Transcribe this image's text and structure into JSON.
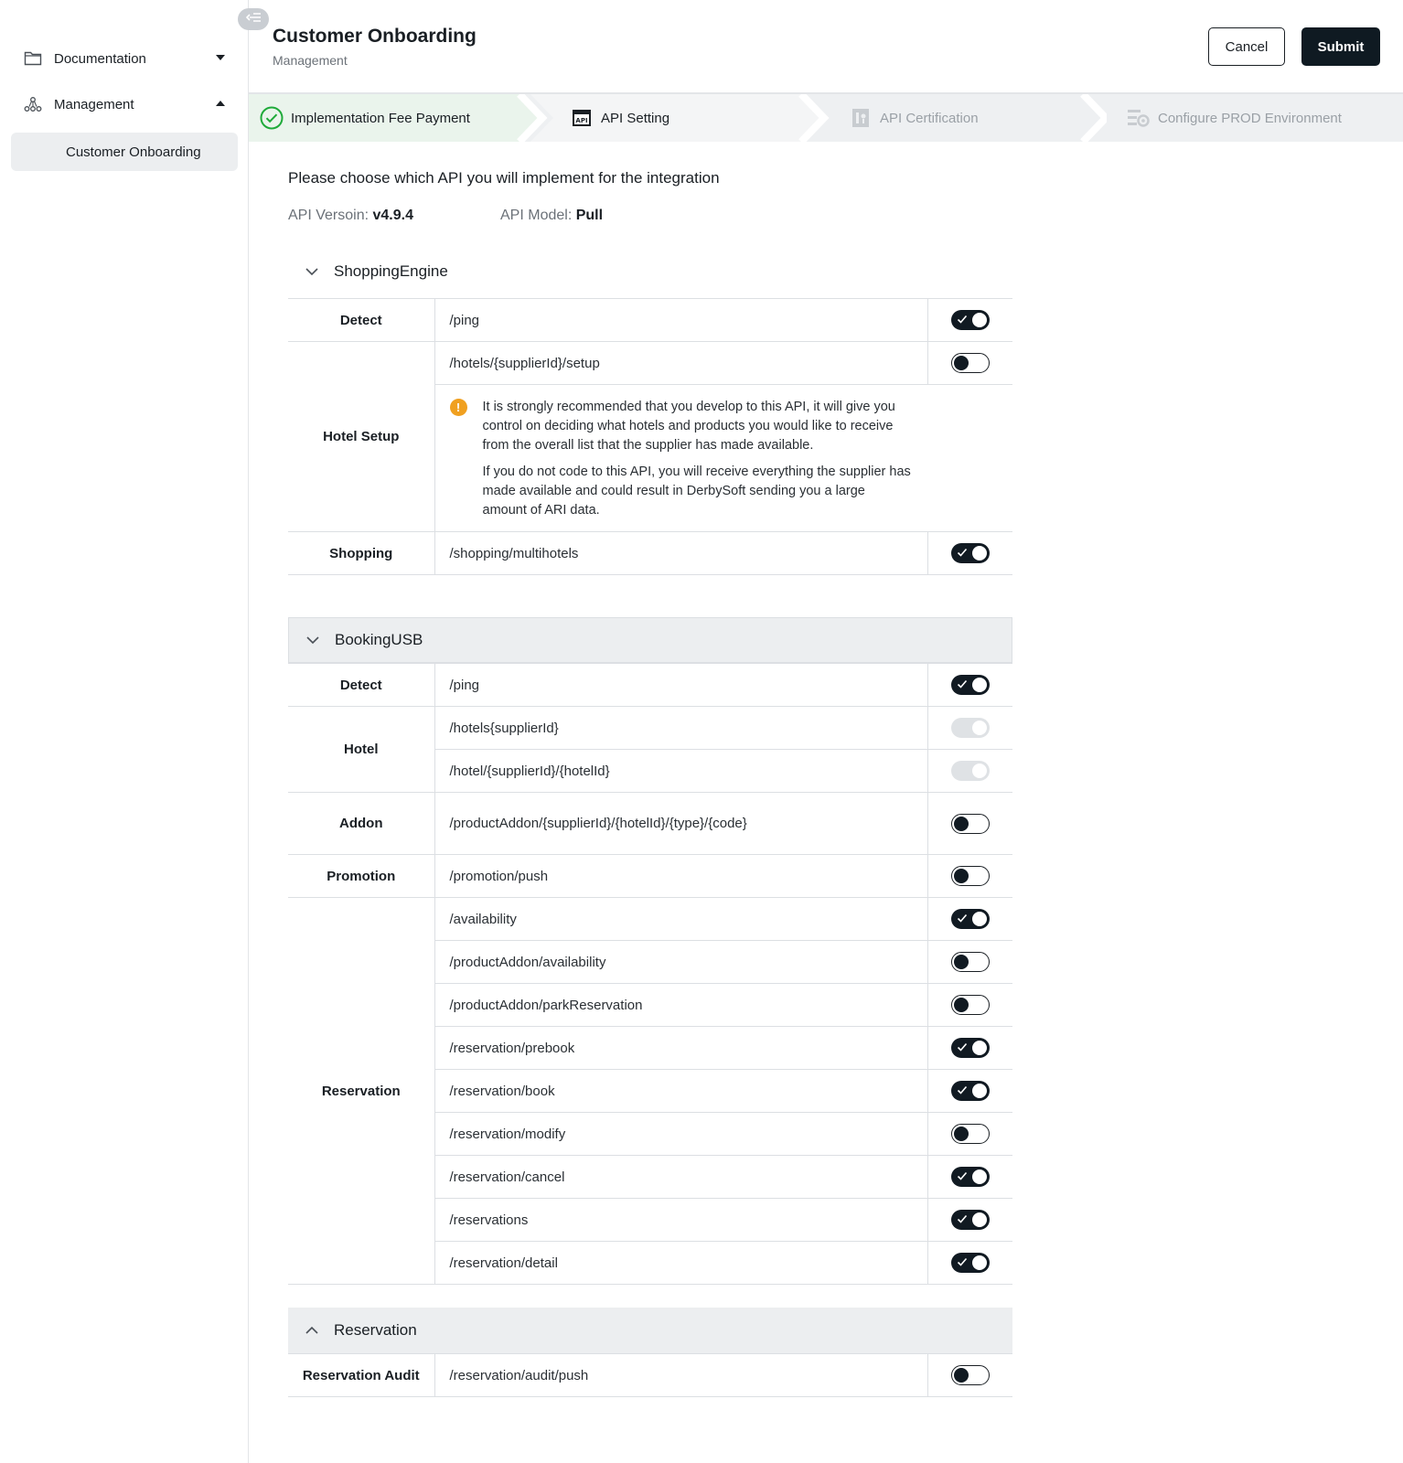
{
  "sidebar": {
    "items": [
      {
        "label": "Documentation",
        "icon": "folder-icon",
        "expanded": false
      },
      {
        "label": "Management",
        "icon": "org-chart-icon",
        "expanded": true
      }
    ],
    "sub_item": "Customer Onboarding"
  },
  "header": {
    "title": "Customer Onboarding",
    "subtitle": "Management",
    "cancel_label": "Cancel",
    "submit_label": "Submit"
  },
  "steps": [
    {
      "label": "Implementation Fee Payment",
      "state": "done"
    },
    {
      "label": "API Setting",
      "state": "active"
    },
    {
      "label": "API Certification",
      "state": "pending"
    },
    {
      "label": "Configure PROD Environment",
      "state": "pending"
    }
  ],
  "main": {
    "question": "Please choose which API  you will implement for the integration",
    "version_label": "API Versoin:",
    "version_value": "v4.9.4",
    "model_label": "API Model:",
    "model_value": "Pull"
  },
  "groups": [
    {
      "title": "ShoppingEngine",
      "rows": [
        {
          "category": "Detect",
          "path": "/ping",
          "state": "on"
        },
        {
          "category": "Hotel Setup",
          "path": "/hotels/{supplierId}/setup",
          "state": "off"
        },
        {
          "category": "Shopping",
          "path": "/shopping/multihotels",
          "state": "on"
        }
      ],
      "notice": [
        "It is strongly recommended that you develop to this API, it will give you control on deciding what hotels and products you would like to receive from the overall list that the supplier has made available.",
        "If you do not code to this API, you will receive everything the supplier has made available and could result in DerbySoft sending you a large amount of ARI data."
      ]
    },
    {
      "title": "BookingUSB",
      "rows": [
        {
          "category": "Detect",
          "path": "/ping",
          "state": "on"
        },
        {
          "category": "Hotel",
          "path": "/hotels{supplierId}",
          "state": "disabled"
        },
        {
          "category": "Hotel",
          "path": "/hotel/{supplierId}/{hotelId}",
          "state": "disabled"
        },
        {
          "category": "Addon",
          "path": "/productAddon/{supplierId}/{hotelId}/{type}/{code}",
          "state": "off"
        },
        {
          "category": "Promotion",
          "path": "/promotion/push",
          "state": "off"
        },
        {
          "category": "Reservation",
          "path": "/availability",
          "state": "on"
        },
        {
          "category": "Reservation",
          "path": "/productAddon/availability",
          "state": "off"
        },
        {
          "category": "Reservation",
          "path": "/productAddon/parkReservation",
          "state": "off"
        },
        {
          "category": "Reservation",
          "path": "/reservation/prebook",
          "state": "on"
        },
        {
          "category": "Reservation",
          "path": "/reservation/book",
          "state": "on"
        },
        {
          "category": "Reservation",
          "path": "/reservation/modify",
          "state": "off"
        },
        {
          "category": "Reservation",
          "path": "/reservation/cancel",
          "state": "on"
        },
        {
          "category": "Reservation",
          "path": "/reservations",
          "state": "on"
        },
        {
          "category": "Reservation",
          "path": "/reservation/detail",
          "state": "on"
        }
      ]
    },
    {
      "title": "Reservation",
      "rows": [
        {
          "category": "Reservation Audit",
          "path": "/reservation/audit/push",
          "state": "off"
        }
      ]
    }
  ],
  "colors": {
    "primary": "#0f1a22",
    "success": "#1faa3a",
    "warning": "#f0a020",
    "muted": "#9aa0a6"
  }
}
